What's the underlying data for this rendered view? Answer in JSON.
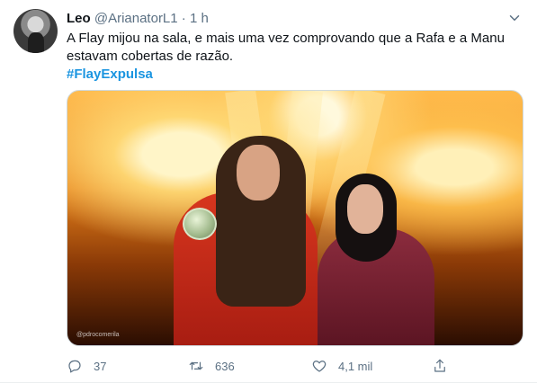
{
  "tweet": {
    "author_name": "Leo",
    "handle": "@ArianatorL1",
    "separator": "·",
    "time": "1 h",
    "text_line1": "A Flay mijou na sala, e mais uma vez comprovando que a Rafa e a Manu",
    "text_line2": "estavam cobertas de razão.",
    "hashtag": "#FlayExpulsa",
    "media_watermark": "@pdrocomerila"
  },
  "actions": {
    "reply_count": "37",
    "retweet_count": "636",
    "like_count": "4,1 mil"
  },
  "icons": {
    "caret": "chevron-down-icon",
    "reply": "speech-bubble-icon",
    "retweet": "retweet-icon",
    "like": "heart-icon",
    "share": "share-icon"
  },
  "colors": {
    "text": "#0f1419",
    "secondary": "#5b7083",
    "link": "#1b95e0"
  }
}
